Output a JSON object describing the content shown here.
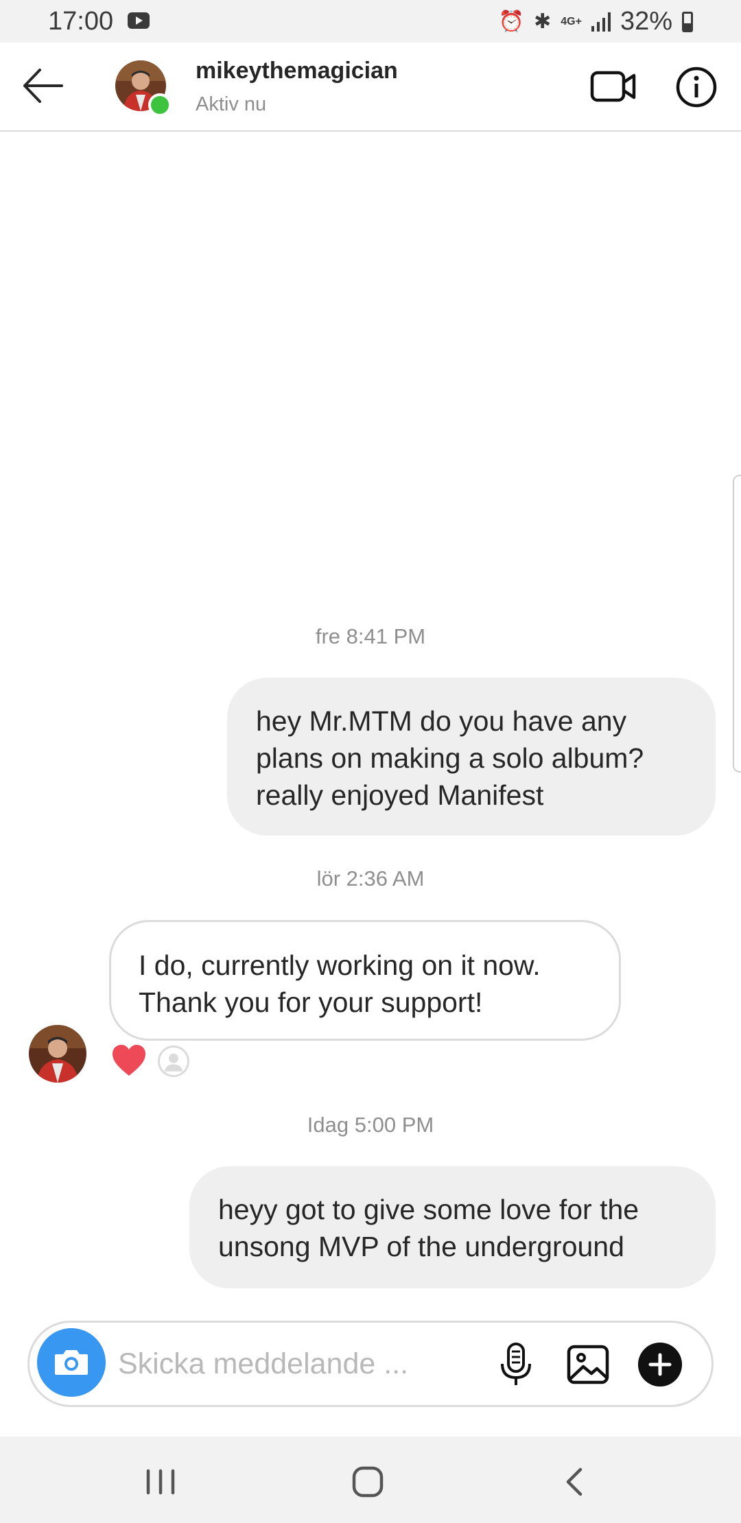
{
  "status_bar": {
    "time": "17:00",
    "network": "4G+",
    "battery": "32%",
    "icons": [
      "youtube-icon",
      "alarm-icon",
      "bluetooth-icon",
      "signal-icon",
      "battery-icon"
    ]
  },
  "header": {
    "username": "mikeythemagician",
    "status": "Aktiv nu",
    "icons": [
      "back-arrow-icon",
      "video-call-icon",
      "info-icon"
    ]
  },
  "chat": {
    "ts1": "fre 8:41 PM",
    "msg1": "hey Mr.MTM do you have any plans on making a solo album? really enjoyed Manifest",
    "ts2": "lör 2:36 AM",
    "msg2": "I do, currently working on it now. Thank you for your support!",
    "reaction": "heart-icon",
    "ts3": "Idag 5:00 PM",
    "msg3": "heyy got to give some love for the unsong MVP of the underground"
  },
  "composer": {
    "placeholder": "Skicka meddelande ...",
    "icons": [
      "camera-icon",
      "microphone-icon",
      "gallery-icon",
      "plus-icon"
    ]
  },
  "colors": {
    "accent": "#3897f0",
    "online": "#3ec33e",
    "heart": "#ed4956",
    "outgoing_bubble": "#efefef"
  }
}
